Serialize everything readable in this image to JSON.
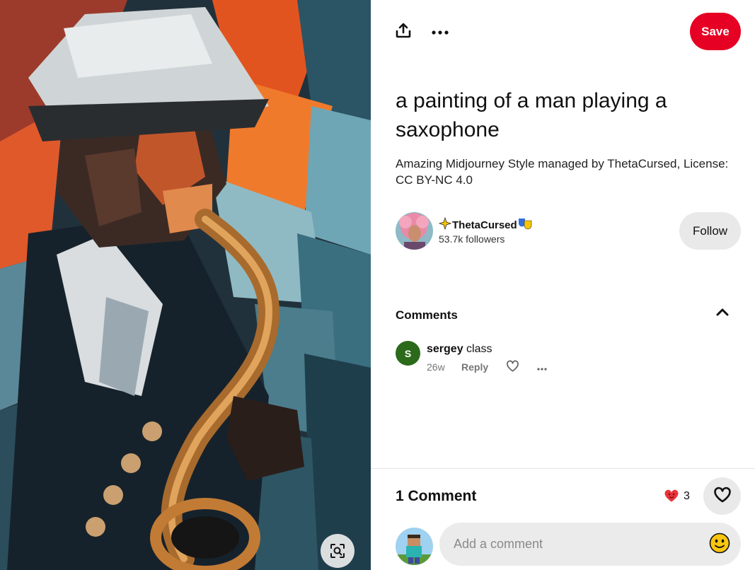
{
  "pin": {
    "title": "a painting of a man playing a saxophone",
    "description": "Amazing Midjourney Style managed by ThetaCursed, License: CC BY-NC 4.0",
    "save_label": "Save"
  },
  "toolbar": {
    "share_icon": "share-icon",
    "more_icon": "more-options-icon"
  },
  "creator": {
    "name": "ThetaCursed",
    "followers": "53.7k followers",
    "follow_label": "Follow"
  },
  "comments": {
    "header": "Comments",
    "items": [
      {
        "initial": "S",
        "author": "sergey",
        "text": "class",
        "time": "26w",
        "reply_label": "Reply"
      }
    ]
  },
  "footer": {
    "count_label": "1 Comment",
    "reaction_count": "3",
    "input_placeholder": "Add a comment"
  },
  "colors": {
    "save_red": "#e60023",
    "button_gray": "#e9e9e9",
    "comment_avatar_green": "#2b6a1b"
  }
}
